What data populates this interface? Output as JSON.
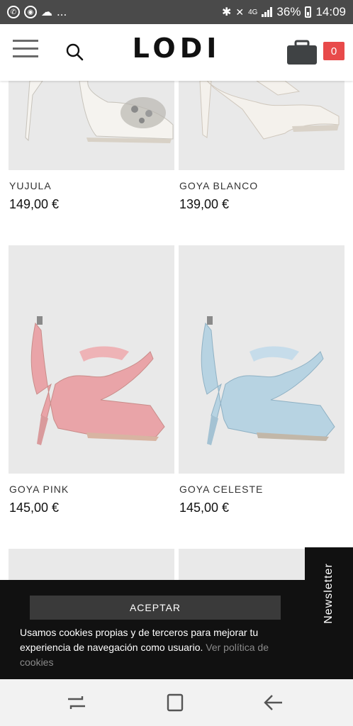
{
  "status_bar": {
    "left_extra": "...",
    "network": "4G",
    "battery": "36%",
    "time": "14:09"
  },
  "header": {
    "logo": "LODI",
    "cart_count": "0"
  },
  "products": [
    {
      "name": "YUJULA",
      "price": "149,00 €",
      "color": "#f5f3ef",
      "accent": "#b9b6b0"
    },
    {
      "name": "GOYA BLANCO",
      "price": "139,00 €",
      "color": "#f4f1ec",
      "accent": "#cfc7bc"
    },
    {
      "name": "GOYA PINK",
      "price": "145,00 €",
      "color": "#e9a4a8",
      "accent": "#c98c89"
    },
    {
      "name": "GOYA CELESTE",
      "price": "145,00 €",
      "color": "#b7d3e2",
      "accent": "#8fb1c4"
    }
  ],
  "newsletter_tab": "Newsletter",
  "cookie_banner": {
    "accept_label": "ACEPTAR",
    "text": "Usamos cookies propias y de terceros para mejorar tu experiencia de navegación como usuario.",
    "link": "Ver política de cookies"
  },
  "colors": {
    "status_bar_bg": "#4a4a4a",
    "cart_badge": "#e84a4a",
    "cookie_bg": "#111111"
  }
}
